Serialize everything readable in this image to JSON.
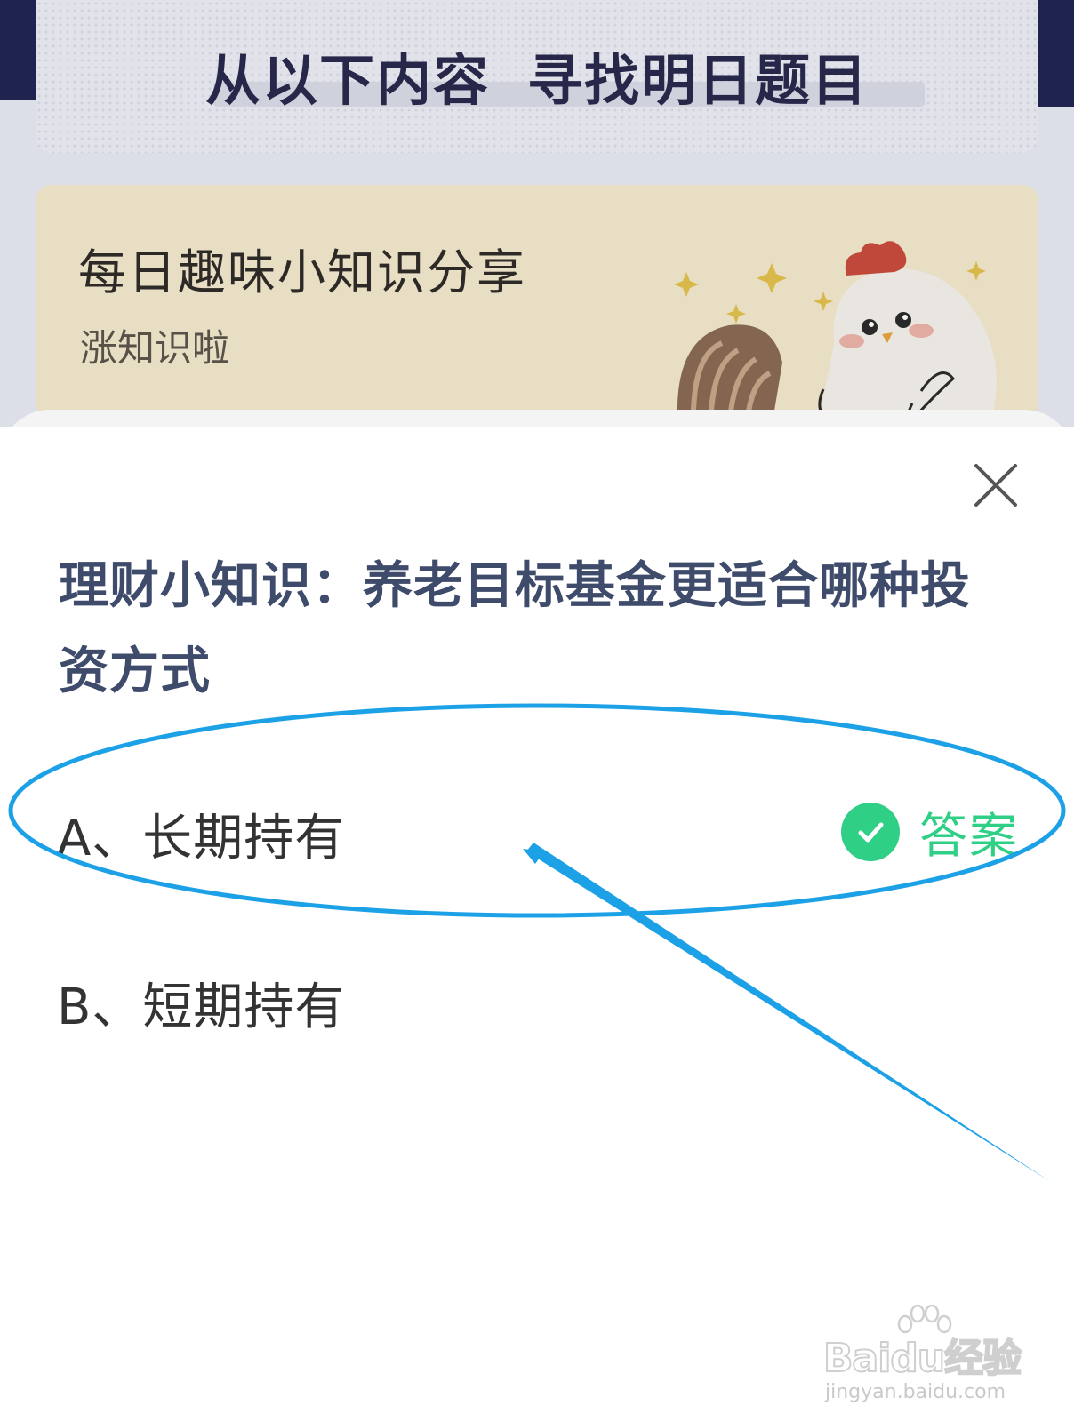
{
  "background": {
    "header_title_part1": "从以下内容",
    "header_title_part2": "寻找明日题目",
    "tip_card": {
      "title": "每日趣味小知识分享",
      "subtitle": "涨知识啦"
    }
  },
  "modal": {
    "question": "理财小知识：养老目标基金更适合哪种投资方式",
    "options": [
      {
        "label": "A、长期持有",
        "is_answer": true
      },
      {
        "label": "B、短期持有",
        "is_answer": false
      }
    ],
    "answer_label": "答案"
  },
  "watermark": {
    "brand": "Baidu经验",
    "url": "jingyan.baidu.com"
  },
  "colors": {
    "question_text": "#3f4b6b",
    "answer_green": "#2fcf86",
    "annotation_blue": "#1da1e6",
    "header_dark": "#26284a"
  },
  "icons": {
    "close": "close-icon",
    "answer": "check-circle-icon",
    "mascot": "chicken-mascot-icon"
  }
}
